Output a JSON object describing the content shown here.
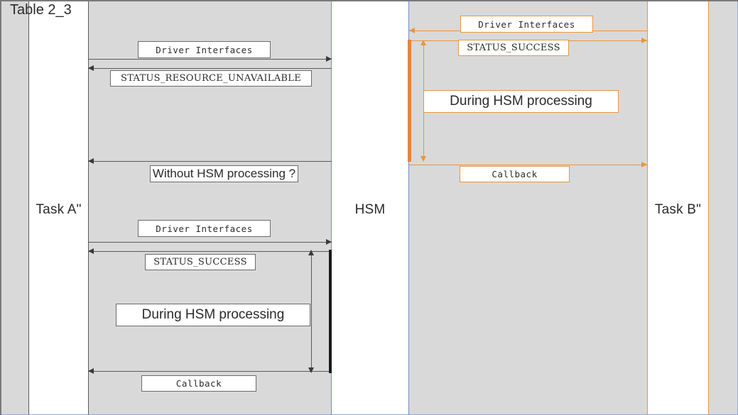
{
  "diagram": {
    "title": "Table 2_3",
    "type": "sequence-diagram",
    "background_color": "#d9d9d9",
    "accent_color": "#e8963c",
    "frame_color": "#8fa9d4"
  },
  "lifelines": [
    {
      "id": "task-a",
      "label": "Task A\"",
      "border_color": "#595959"
    },
    {
      "id": "hsm",
      "label": "HSM",
      "border_color": "#6f8fc9"
    },
    {
      "id": "task-b",
      "label": "Task B\"",
      "border_color": "#e8963c"
    }
  ],
  "left_sequence": {
    "messages": [
      {
        "id": "m1",
        "label": "Driver Interfaces",
        "direction": "right",
        "style": "mono"
      },
      {
        "id": "m2",
        "label": "STATUS_RESOURCE_UNAVAILABLE",
        "direction": "left",
        "style": "serifmono"
      },
      {
        "id": "m3",
        "label": "Without HSM processing ?",
        "direction": "left",
        "style": "sans"
      },
      {
        "id": "m4",
        "label": "Driver Interfaces",
        "direction": "right",
        "style": "mono"
      },
      {
        "id": "m5",
        "label": "STATUS_SUCCESS",
        "direction": "left",
        "style": "serifmono"
      },
      {
        "id": "m6",
        "label": "During HSM processing",
        "direction": "none",
        "style": "sans"
      },
      {
        "id": "m7",
        "label": "Callback",
        "direction": "left",
        "style": "mono"
      }
    ]
  },
  "right_sequence": {
    "messages": [
      {
        "id": "r1",
        "label": "Driver Interfaces",
        "direction": "left",
        "style": "mono"
      },
      {
        "id": "r2",
        "label": "STATUS_SUCCESS",
        "direction": "right",
        "style": "serifmono"
      },
      {
        "id": "r3",
        "label": "During HSM processing",
        "direction": "none",
        "style": "sans"
      },
      {
        "id": "r4",
        "label": "Callback",
        "direction": "right",
        "style": "mono"
      }
    ]
  }
}
